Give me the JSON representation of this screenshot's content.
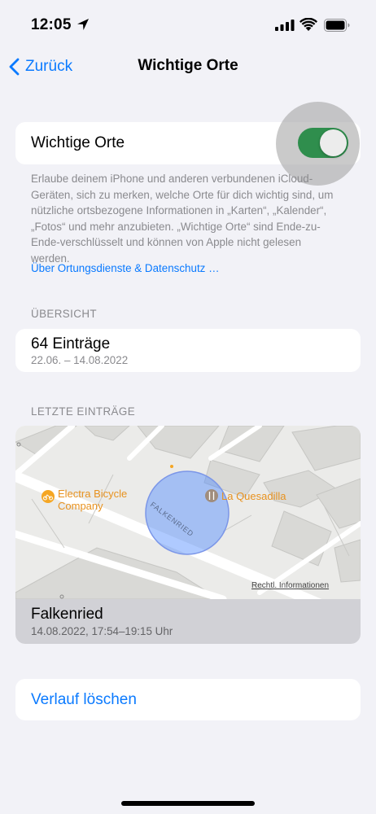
{
  "status_bar": {
    "time": "12:05"
  },
  "nav": {
    "back_label": "Zurück",
    "title": "Wichtige Orte"
  },
  "toggle_section": {
    "label": "Wichtige Orte",
    "enabled": true,
    "footer_text": "Erlaube deinem iPhone und anderen verbundenen iCloud-Geräten, sich zu merken, welche Orte für dich wichtig sind, um nützliche ortsbezogene Informationen in „Karten“, „Kalender“, „Fotos“ und mehr anzubieten. „Wichtige Orte“ sind Ende-zu-Ende-verschlüsselt und können von Apple nicht gelesen werden.",
    "footer_link": "Über Ortungsdienste & Datenschutz …"
  },
  "overview": {
    "header": "ÜBERSICHT",
    "count": "64 Einträge",
    "date_range": "22.06. – 14.08.2022"
  },
  "recent": {
    "header": "LETZTE EINTRÄGE",
    "map": {
      "poi_1": "Electra Bicycle",
      "poi_1_line2": "Company",
      "poi_2": "La Quesadilla",
      "street": "FALKENRIED",
      "legal": "Rechtl. Informationen"
    },
    "place_name": "Falkenried",
    "place_time": "14.08.2022, 17:54–19:15 Uhr"
  },
  "clear_history": {
    "label": "Verlauf löschen"
  },
  "colors": {
    "accent": "#0a7aff",
    "toggle_on": "#2f8e4d",
    "background": "#f2f2f7",
    "secondary_text": "#8a8a8e",
    "poi_orange": "#f5a623",
    "poi_brown": "#a08d7d"
  }
}
